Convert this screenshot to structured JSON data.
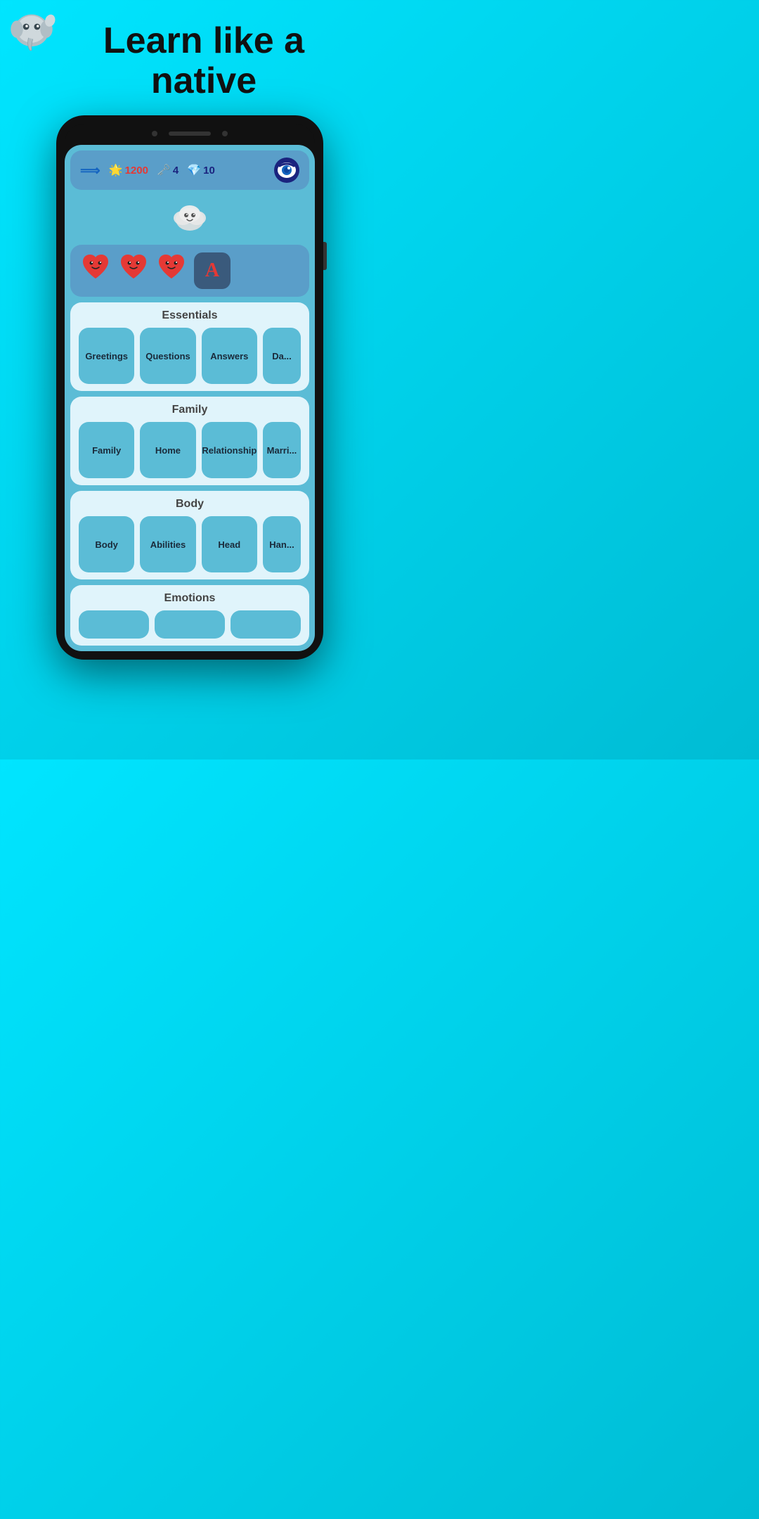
{
  "headline": {
    "line1": "Learn like a",
    "line2": "native"
  },
  "stats": {
    "sun_value": "1200",
    "key_value": "4",
    "diamond_value": "10"
  },
  "hearts": {
    "count": 3,
    "heart_char": "❤️"
  },
  "sections": [
    {
      "id": "essentials",
      "title": "Essentials",
      "items": [
        {
          "label": "Greetings",
          "partial": false
        },
        {
          "label": "Questions",
          "partial": false
        },
        {
          "label": "Answers",
          "partial": false
        },
        {
          "label": "Da...",
          "partial": true
        }
      ]
    },
    {
      "id": "family",
      "title": "Family",
      "items": [
        {
          "label": "Family",
          "partial": false
        },
        {
          "label": "Home",
          "partial": false
        },
        {
          "label": "Relationship",
          "partial": false
        },
        {
          "label": "Marri...",
          "partial": true
        }
      ]
    },
    {
      "id": "body",
      "title": "Body",
      "items": [
        {
          "label": "Body",
          "partial": false
        },
        {
          "label": "Abilities",
          "partial": false
        },
        {
          "label": "Head",
          "partial": false
        },
        {
          "label": "Han...",
          "partial": true
        }
      ]
    },
    {
      "id": "emotions",
      "title": "Emotions",
      "items": []
    }
  ]
}
